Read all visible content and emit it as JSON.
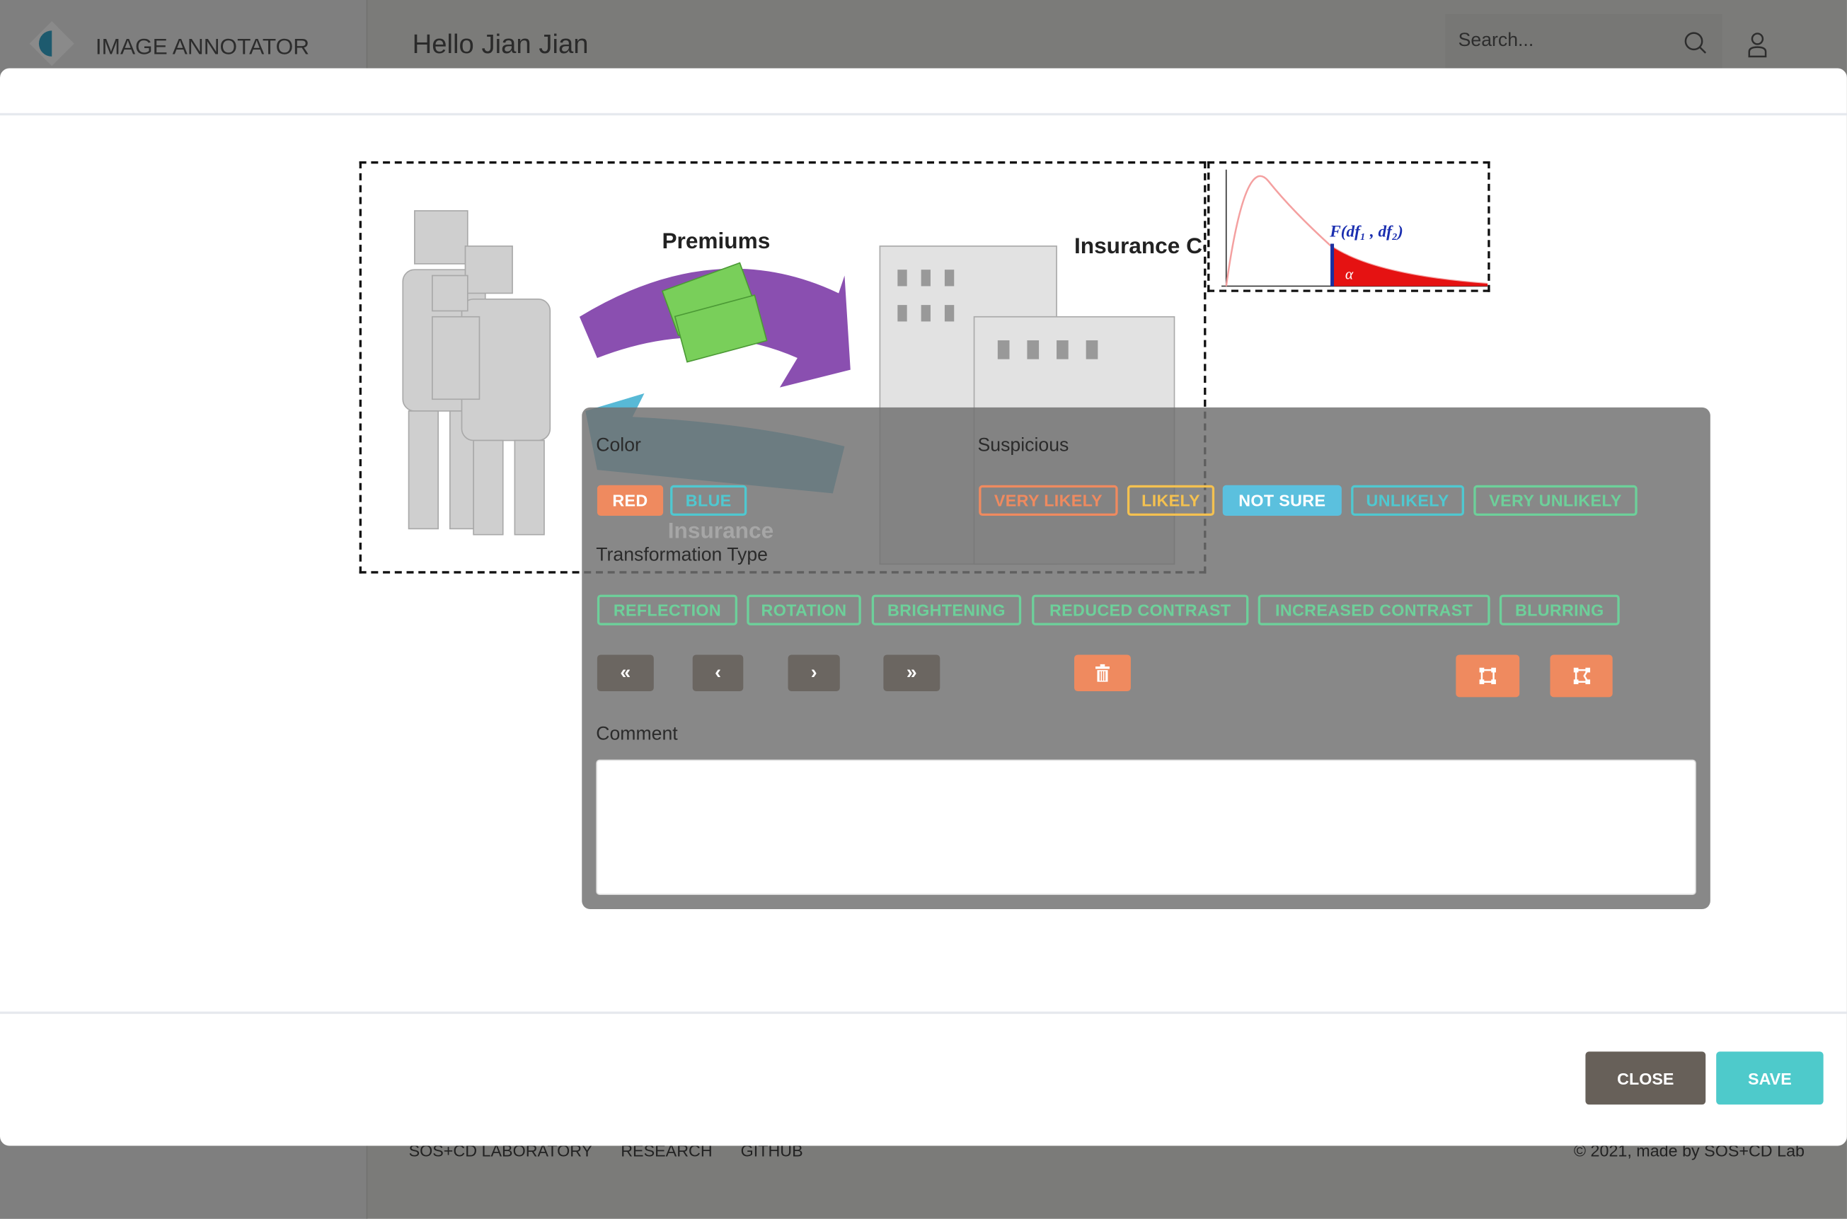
{
  "app": {
    "title": "IMAGE ANNOTATOR",
    "greeting": "Hello Jian Jian",
    "search_placeholder": "Search..."
  },
  "footer": {
    "links": [
      "SOS+CD LABORATORY",
      "RESEARCH",
      "GITHUB"
    ],
    "copyright": "© 2021, made by SOS+CD Lab"
  },
  "image": {
    "labels": {
      "premiums": "Premiums",
      "company": "Insurance Company",
      "insurance": "Insurance",
      "formula": "F(df₁ , df₂)",
      "alpha": "α"
    }
  },
  "panel": {
    "color_label": "Color",
    "colors": [
      {
        "label": "RED",
        "selected": true,
        "color": "#ef8a5f"
      },
      {
        "label": "BLUE",
        "selected": false,
        "color": "#4fc8d0"
      }
    ],
    "suspicious_label": "Suspicious",
    "suspicious": [
      {
        "label": "VERY LIKELY",
        "color": "#ef8a5f",
        "selected": false
      },
      {
        "label": "LIKELY",
        "color": "#f4c150",
        "selected": false
      },
      {
        "label": "NOT SURE",
        "color": "#5bc0de",
        "selected": true
      },
      {
        "label": "UNLIKELY",
        "color": "#4fc8d0",
        "selected": false
      },
      {
        "label": "VERY UNLIKELY",
        "color": "#6dd09a",
        "selected": false
      }
    ],
    "transformation_label": "Transformation Type",
    "transformations": [
      "REFLECTION",
      "ROTATION",
      "BRIGHTENING",
      "REDUCED CONTRAST",
      "INCREASED CONTRAST",
      "BLURRING"
    ],
    "nav": {
      "first": "«",
      "prev": "‹",
      "next": "›",
      "last": "»"
    },
    "comment_label": "Comment",
    "comment_value": ""
  },
  "modal_footer": {
    "close": "CLOSE",
    "save": "SAVE"
  },
  "colors": {
    "accent_orange": "#ef8a5f",
    "accent_teal": "#4ecacb",
    "dark_button": "#676059",
    "green": "#6dd09a"
  }
}
